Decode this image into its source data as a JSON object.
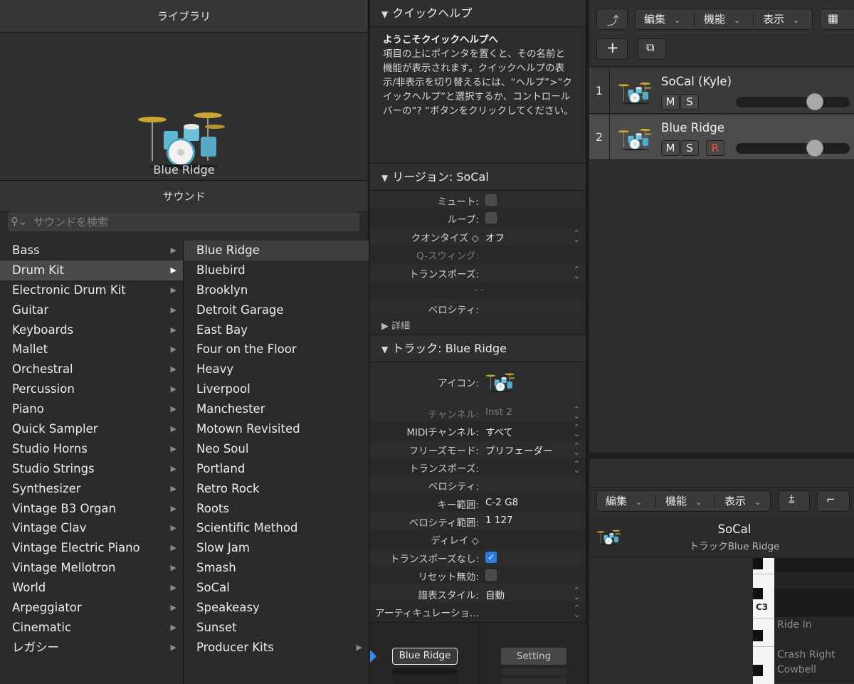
{
  "library": {
    "title": "ライブラリ",
    "preview_name": "Blue Ridge",
    "sound_title": "サウンド",
    "search_placeholder": "サウンドを検索",
    "categories": [
      {
        "label": "Bass",
        "arrow": "▶"
      },
      {
        "label": "Drum Kit",
        "arrow": "▶"
      },
      {
        "label": "Electronic Drum Kit",
        "arrow": "▶"
      },
      {
        "label": "Guitar",
        "arrow": "▶"
      },
      {
        "label": "Keyboards",
        "arrow": "▶"
      },
      {
        "label": "Mallet",
        "arrow": "▶"
      },
      {
        "label": "Orchestral",
        "arrow": "▶"
      },
      {
        "label": "Percussion",
        "arrow": "▶"
      },
      {
        "label": "Piano",
        "arrow": "▶"
      },
      {
        "label": "Quick Sampler",
        "arrow": "▶"
      },
      {
        "label": "Studio Horns",
        "arrow": "▶"
      },
      {
        "label": "Studio Strings",
        "arrow": "▶"
      },
      {
        "label": "Synthesizer",
        "arrow": "▶"
      },
      {
        "label": "Vintage B3 Organ",
        "arrow": "▶"
      },
      {
        "label": "Vintage Clav",
        "arrow": "▶"
      },
      {
        "label": "Vintage Electric Piano",
        "arrow": "▶"
      },
      {
        "label": "Vintage Mellotron",
        "arrow": "▶"
      },
      {
        "label": "World",
        "arrow": "▶"
      },
      {
        "label": "Arpeggiator",
        "arrow": "▶"
      },
      {
        "label": "Cinematic",
        "arrow": "▶"
      },
      {
        "label": "レガシー",
        "arrow": "▶"
      }
    ],
    "kits": [
      {
        "label": "Blue Ridge",
        "arrow": ""
      },
      {
        "label": "Bluebird",
        "arrow": ""
      },
      {
        "label": "Brooklyn",
        "arrow": ""
      },
      {
        "label": "Detroit Garage",
        "arrow": ""
      },
      {
        "label": "East Bay",
        "arrow": ""
      },
      {
        "label": "Four on the Floor",
        "arrow": ""
      },
      {
        "label": "Heavy",
        "arrow": ""
      },
      {
        "label": "Liverpool",
        "arrow": ""
      },
      {
        "label": "Manchester",
        "arrow": ""
      },
      {
        "label": "Motown Revisited",
        "arrow": ""
      },
      {
        "label": "Neo Soul",
        "arrow": ""
      },
      {
        "label": "Portland",
        "arrow": ""
      },
      {
        "label": "Retro Rock",
        "arrow": ""
      },
      {
        "label": "Roots",
        "arrow": ""
      },
      {
        "label": "Scientific Method",
        "arrow": ""
      },
      {
        "label": "Slow Jam",
        "arrow": ""
      },
      {
        "label": "Smash",
        "arrow": ""
      },
      {
        "label": "SoCal",
        "arrow": ""
      },
      {
        "label": "Speakeasy",
        "arrow": ""
      },
      {
        "label": "Sunset",
        "arrow": ""
      },
      {
        "label": "Producer Kits",
        "arrow": "▶"
      }
    ]
  },
  "inspector": {
    "quickhelp": {
      "header": "クイックヘルプ",
      "title": "ようこそクイックヘルプへ",
      "body": "項目の上にポインタを置くと、その名前と機能が表示されます。クイックヘルプの表示/非表示を切り替えるには、“ヘルプ”>“クイックヘルプ”と選択するか、コントロールバーの“? ”ボタンをクリックしてください。"
    },
    "region": {
      "header": "リージョン: SoCal",
      "mute_label": "ミュート:",
      "loop_label": "ループ:",
      "quantize_label": "クオンタイズ ◇",
      "quantize_value": "オフ",
      "swing_label": "Q-スウィング:",
      "transpose_label": "トランスポーズ:",
      "dash_value": "- -",
      "velocity_label": "ベロシティ:",
      "detail_label": "詳細"
    },
    "track": {
      "header": "トラック: Blue Ridge",
      "icon_label": "アイコン:",
      "channel_label": "チャンネル:",
      "channel_value": "Inst 2",
      "midi_label": "MIDIチャンネル:",
      "midi_value": "すべて",
      "freeze_label": "フリーズモード:",
      "freeze_value": "プリフェーダー",
      "transpose_label": "トランスポーズ:",
      "velocity_label": "ベロシティ:",
      "keyrange_label": "キー範囲:",
      "keyrange_value": "C-2  G8",
      "velrange_label": "ベロシティ範囲:",
      "velrange_value": "1  127",
      "delay_label": "ディレイ ◇",
      "notranspose_label": "トランスポーズなし:",
      "reset_label": "リセット無効:",
      "score_label": "譜表スタイル:",
      "score_value": "自動",
      "articulation_label": "アーティキュレーショ…"
    },
    "bottom": {
      "patch_button": "Blue Ridge",
      "setting_button": "Setting"
    }
  },
  "tracks_area": {
    "menus": [
      "編集",
      "機能",
      "表示"
    ],
    "tracks": [
      {
        "num": "1",
        "name": "SoCal (Kyle)",
        "m": "M",
        "s": "S",
        "r": "",
        "volume": 0.73
      },
      {
        "num": "2",
        "name": "Blue Ridge",
        "m": "M",
        "s": "S",
        "r": "R",
        "volume": 0.73
      }
    ]
  },
  "editor": {
    "menus": [
      "編集",
      "機能",
      "表示"
    ],
    "region_name": "SoCal",
    "track_info": "トラックBlue Ridge",
    "c3_label": "C3",
    "lanes": [
      "Ride In",
      "Crash Right",
      "Cowbell"
    ]
  },
  "colors": {
    "accent_blue": "#2f7ae5",
    "record_red": "#ff4a3a"
  }
}
